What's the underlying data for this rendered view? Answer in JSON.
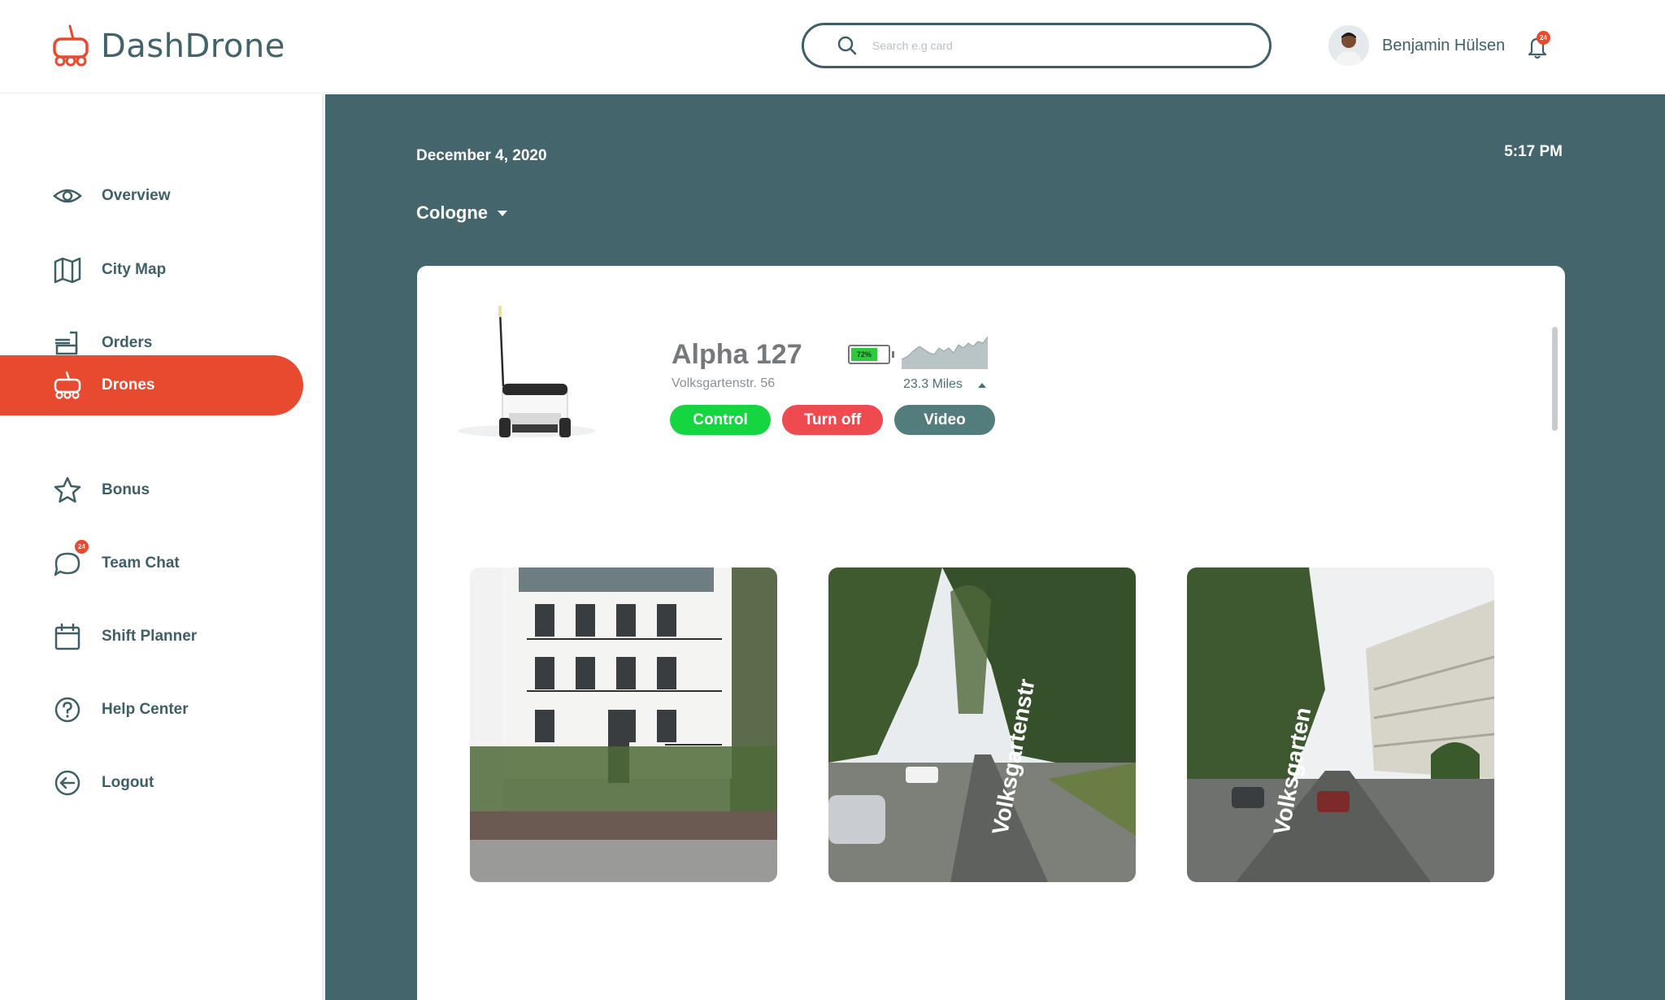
{
  "app": {
    "name": "DashDrone"
  },
  "search": {
    "placeholder": "Search e.g card"
  },
  "user": {
    "name": "Benjamin Hülsen",
    "notification_count": "24"
  },
  "nav": {
    "items": [
      {
        "label": "Overview",
        "icon": "eye-icon"
      },
      {
        "label": "City Map",
        "icon": "map-icon"
      },
      {
        "label": "Orders",
        "icon": "orders-icon"
      },
      {
        "label": "Drones",
        "icon": "drone-icon",
        "active": true
      },
      {
        "label": "Bonus",
        "icon": "star-icon"
      },
      {
        "label": "Team Chat",
        "icon": "chat-icon",
        "badge": "24"
      },
      {
        "label": "Shift Planner",
        "icon": "calendar-icon"
      },
      {
        "label": "Help Center",
        "icon": "help-icon"
      },
      {
        "label": "Logout",
        "icon": "logout-icon"
      }
    ]
  },
  "main": {
    "date": "December 4, 2020",
    "time": "5:17 PM",
    "city": "Cologne"
  },
  "drone": {
    "name": "Alpha 127",
    "address": "Volksgartenstr. 56",
    "battery": "72%",
    "battery_level": 0.72,
    "distance": "23.3 Miles",
    "buttons": {
      "control": "Control",
      "turn_off": "Turn off",
      "video": "Video"
    }
  },
  "colors": {
    "accent": "#e84a2f",
    "main_bg": "#44656b",
    "text": "#3f5f67",
    "control": "#15d640",
    "turn_off": "#ef4a4f",
    "video": "#527d7c"
  }
}
